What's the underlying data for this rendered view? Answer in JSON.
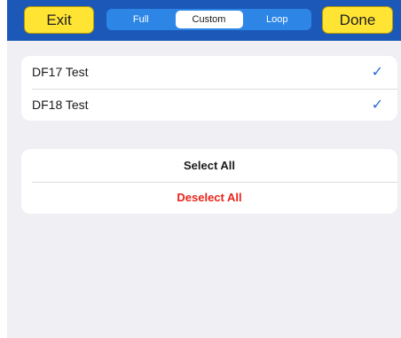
{
  "toolbar": {
    "exit_label": "Exit",
    "done_label": "Done",
    "segments": [
      "Full",
      "Custom",
      "Loop"
    ],
    "selected_segment": "Custom"
  },
  "tests": [
    {
      "label": "DF17 Test",
      "checked": true,
      "check_glyph": "✓"
    },
    {
      "label": "DF18 Test",
      "checked": true,
      "check_glyph": "✓"
    }
  ],
  "actions": {
    "select_all": "Select All",
    "deselect_all": "Deselect All"
  },
  "colors": {
    "toolbar_bg": "#1c58b8",
    "button_yellow": "#ffe433",
    "segment_blue": "#2d86e6",
    "check_blue": "#2a6ad6",
    "destructive_red": "#e8241c",
    "page_bg": "#efeff4"
  }
}
